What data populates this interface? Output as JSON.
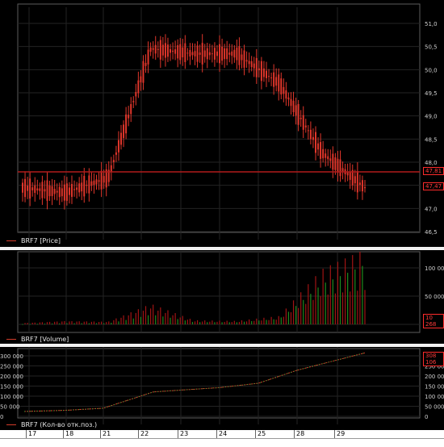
{
  "price_pane": {
    "legend": "BRF7 [Price]",
    "y_ticks": [
      "51,0",
      "50,5",
      "50,0",
      "49,5",
      "49,0",
      "48,5",
      "48,0",
      "47,5",
      "47,0",
      "46,5"
    ],
    "line_value": "47,81",
    "last_value": "47,47",
    "colors": {
      "candle": "#e0362b",
      "line": "#b11a1a"
    }
  },
  "volume_pane": {
    "legend": "BRF7 [Volume]",
    "y_ticks": [
      "100 000",
      "50 000",
      "0"
    ],
    "last_value": "10 268"
  },
  "oi_pane": {
    "legend": "BRF7 (Кол-во отк.поз.)",
    "y_ticks": [
      "300 000",
      "250 000",
      "200 000",
      "150 000",
      "100 000",
      "50 000",
      "0"
    ],
    "y_ticks_left": [
      "300 000",
      "250 000",
      "200 000",
      "150 000",
      "100 000",
      "50 000",
      "0"
    ],
    "last_value": "308 106"
  },
  "x_axis": {
    "labels": [
      "17",
      "18",
      "21",
      "22",
      "23",
      "24",
      "25",
      "28",
      "29"
    ]
  },
  "chart_data": [
    {
      "type": "line",
      "title": "BRF7 [Price]",
      "ylim": [
        46.5,
        51.1
      ],
      "x": [
        "17",
        "18",
        "21",
        "22",
        "23",
        "24",
        "25",
        "28",
        "29"
      ],
      "series": [
        {
          "name": "BRF7 [Price]",
          "values": [
            47.4,
            47.3,
            47.6,
            50.2,
            50.1,
            50.1,
            49.5,
            48.1,
            47.4
          ]
        }
      ]
    },
    {
      "type": "bar",
      "title": "BRF7 [Volume]",
      "ylim": [
        0,
        125000
      ],
      "x": [
        "17",
        "18",
        "21",
        "22",
        "23",
        "24",
        "25",
        "28",
        "29"
      ],
      "series": [
        {
          "name": "BRF7 [Volume]",
          "values": [
            2000,
            5000,
            4000,
            30000,
            6000,
            5000,
            12000,
            80000,
            110000
          ]
        }
      ]
    },
    {
      "type": "line",
      "title": "BRF7 (Кол-во отк.поз.)",
      "ylim": [
        0,
        320000
      ],
      "x": [
        "17",
        "18",
        "21",
        "22",
        "23",
        "24",
        "25",
        "28",
        "29"
      ],
      "series": [
        {
          "name": "BRF7 (Кол-во отк.поз.)",
          "values": [
            30000,
            35000,
            45000,
            120000,
            130000,
            140000,
            160000,
            220000,
            300000
          ]
        }
      ]
    }
  ]
}
